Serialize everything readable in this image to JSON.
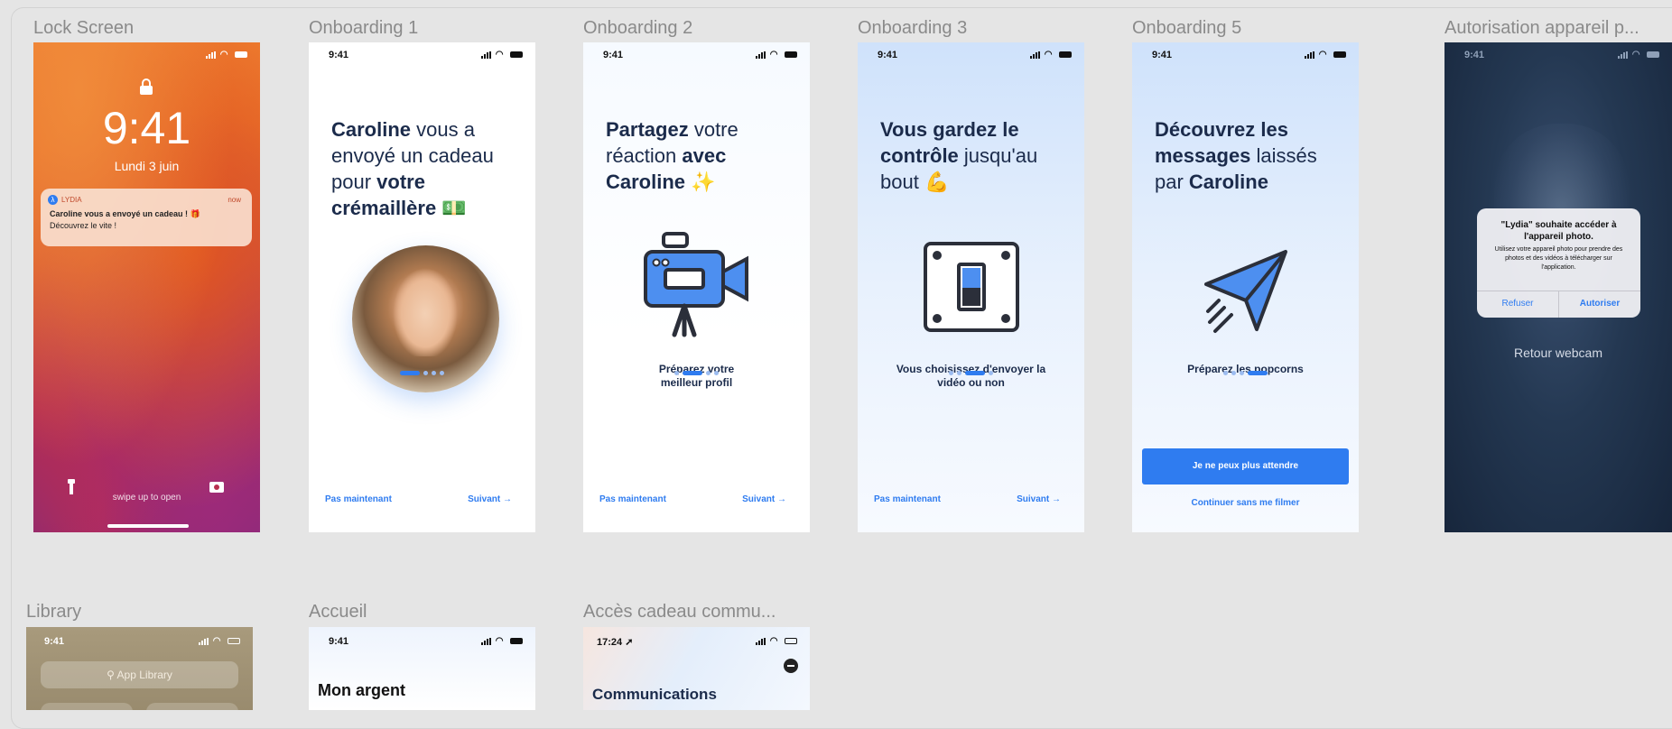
{
  "labels": {
    "lock": "Lock Screen",
    "onb1": "Onboarding 1",
    "onb2": "Onboarding 2",
    "onb3": "Onboarding 3",
    "onb5": "Onboarding 5",
    "auth": "Autorisation appareil p...",
    "library": "Library",
    "accueil": "Accueil",
    "acces": "Accès cadeau commu..."
  },
  "status": {
    "time": "9:41",
    "time_acces": "17:24"
  },
  "lock": {
    "clock": "9:41",
    "date": "Lundi 3 juin",
    "notif_app": "LYDIA",
    "notif_time": "now",
    "notif_title": "Caroline vous a envoyé un cadeau ! 🎁",
    "notif_body": "Découvrez le vite !",
    "swipe": "swipe up to open"
  },
  "onb1": {
    "t1": "Caroline",
    "t2": " vous a envoyé un cadeau pour ",
    "t3": "votre crémaillère",
    "t4": " 💵",
    "skip": "Pas maintenant",
    "next": "Suivant →"
  },
  "onb2": {
    "t1": "Partagez",
    "t2": " votre réaction ",
    "t3": "avec Caroline",
    "t4": " ✨",
    "caption": "Préparez votre meilleur profil",
    "skip": "Pas maintenant",
    "next": "Suivant →"
  },
  "onb3": {
    "t1": "Vous gardez le contrôle",
    "t2": " jusqu'au bout",
    "t3": " 💪",
    "caption": "Vous choisissez d'envoyer la vidéo ou non",
    "skip": "Pas maintenant",
    "next": "Suivant →"
  },
  "onb5": {
    "t1": "Découvrez les messages",
    "t2": " laissés par ",
    "t3": "Caroline",
    "caption": "Préparez les popcorns",
    "cta": "Je ne peux plus attendre",
    "secondary": "Continuer sans me filmer"
  },
  "auth": {
    "title": "\"Lydia\" souhaite accéder à l'appareil photo.",
    "body": "Utilisez votre appareil photo pour prendre des photos et des vidéos à télécharger sur l'application.",
    "deny": "Refuser",
    "allow": "Autoriser",
    "webcam": "Retour webcam"
  },
  "library": {
    "search": "App Library"
  },
  "accueil": {
    "title": "Mon argent"
  },
  "acces": {
    "title": "Communications"
  },
  "colors": {
    "accent": "#2f7cf0",
    "navy": "#1b2b4b"
  }
}
